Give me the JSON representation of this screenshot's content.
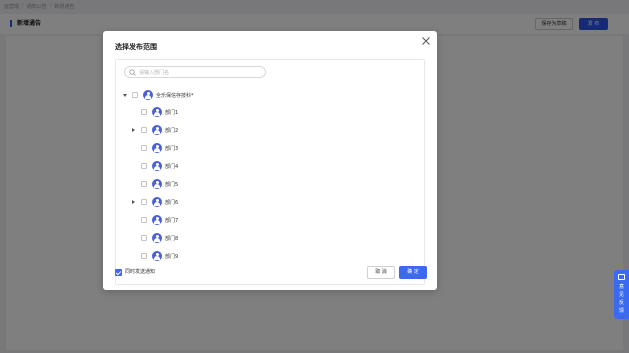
{
  "breadcrumb": [
    "运营端",
    "通知公告",
    "新增通告"
  ],
  "page": {
    "title": "新增通告",
    "save_draft_label": "保存为草稿",
    "publish_label": "发 布"
  },
  "feedback": {
    "label": "意见反馈"
  },
  "modal": {
    "title": "选择发布范围",
    "search_placeholder": "请输入部门名",
    "root": {
      "label": "全乐保信存技科*",
      "expanded": true,
      "checked": false
    },
    "departments": [
      {
        "label": "部门1",
        "has_children": false,
        "checked": false
      },
      {
        "label": "部门2",
        "has_children": true,
        "checked": false
      },
      {
        "label": "部门3",
        "has_children": false,
        "checked": false
      },
      {
        "label": "部门4",
        "has_children": false,
        "checked": false
      },
      {
        "label": "部门5",
        "has_children": false,
        "checked": false
      },
      {
        "label": "部门6",
        "has_children": true,
        "checked": false
      },
      {
        "label": "部门7",
        "has_children": false,
        "checked": false
      },
      {
        "label": "部门8",
        "has_children": false,
        "checked": false
      },
      {
        "label": "部门9",
        "has_children": false,
        "checked": false
      }
    ],
    "notify_label": "同时发送通知",
    "notify_checked": true,
    "cancel_label": "取 消",
    "ok_label": "确 定"
  },
  "colors": {
    "primary": "#3b6af0",
    "avatar": "#4a5fd8",
    "title_accent": "#2b57e8"
  }
}
